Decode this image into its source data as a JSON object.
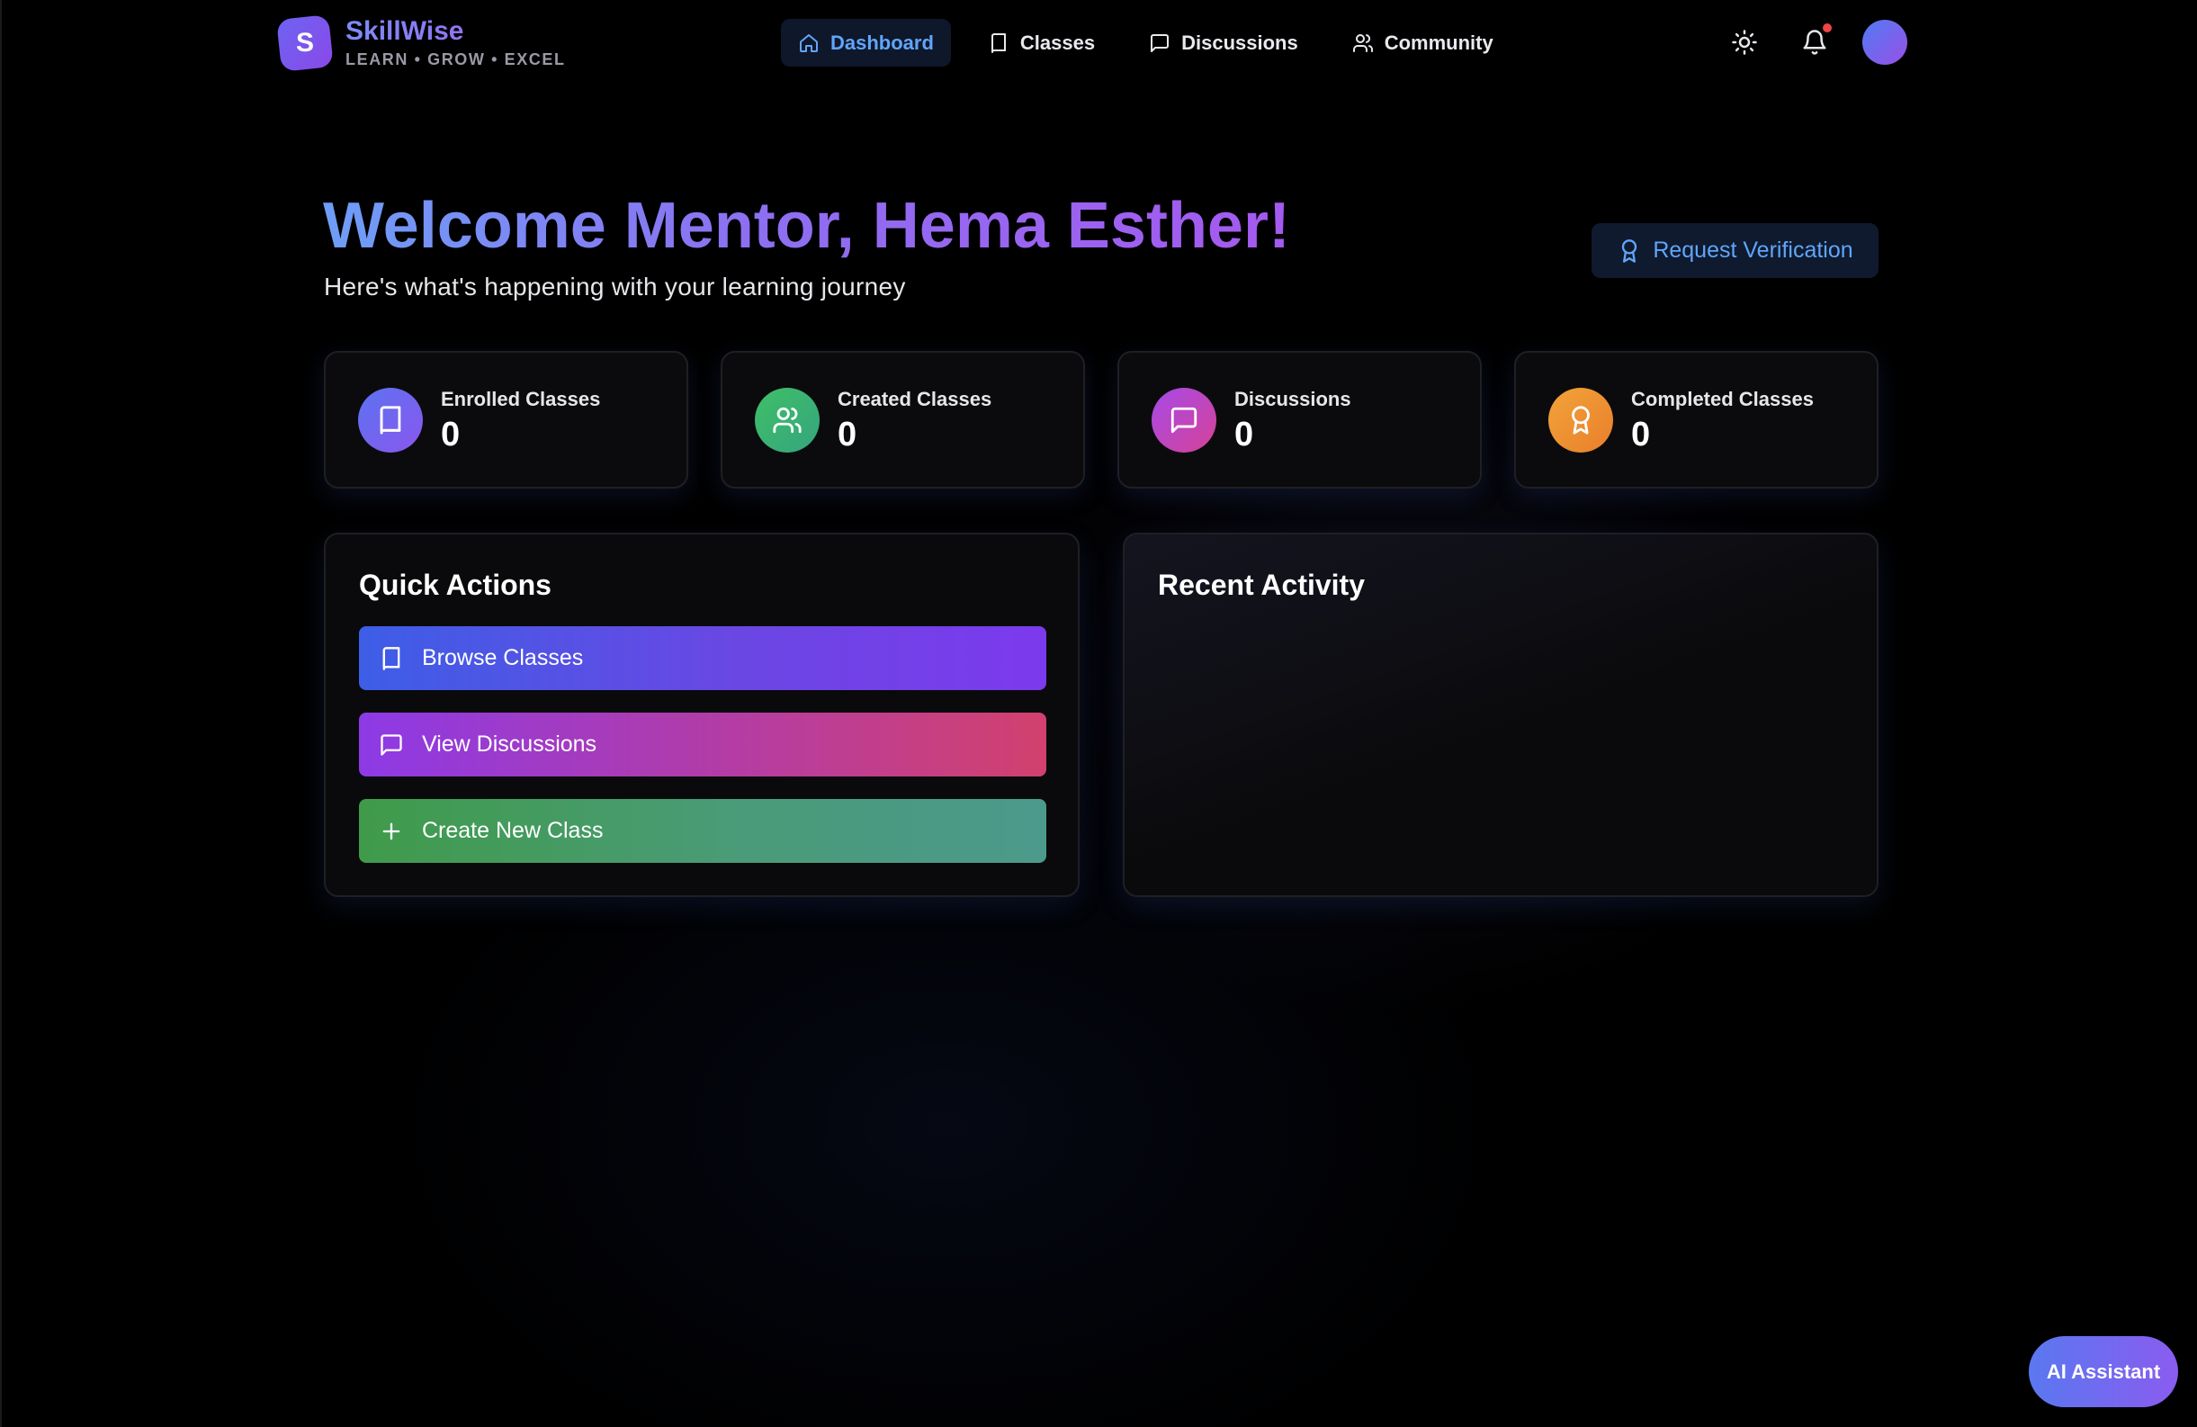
{
  "brand": {
    "logo_letter": "S",
    "name": "SkillWise",
    "tagline": "LEARN • GROW • EXCEL"
  },
  "nav": {
    "items": [
      {
        "label": "Dashboard",
        "icon": "home-icon",
        "active": true
      },
      {
        "label": "Classes",
        "icon": "book-icon",
        "active": false
      },
      {
        "label": "Discussions",
        "icon": "message-square-icon",
        "active": false
      },
      {
        "label": "Community",
        "icon": "users-icon",
        "active": false
      }
    ],
    "right_icons": [
      "sun-icon",
      "bell-icon",
      "avatar"
    ]
  },
  "hero": {
    "title": "Welcome Mentor, Hema Esther!",
    "subtitle": "Here's what's happening with your learning journey",
    "verify_button": "Request Verification"
  },
  "stats": [
    {
      "label": "Enrolled Classes",
      "value": "0",
      "icon": "book-icon",
      "color": "#6366f1"
    },
    {
      "label": "Created Classes",
      "value": "0",
      "icon": "users-icon",
      "color": "#22c55e"
    },
    {
      "label": "Discussions",
      "value": "0",
      "icon": "message-square-icon",
      "color": "#c026d3"
    },
    {
      "label": "Completed Classes",
      "value": "0",
      "icon": "award-icon",
      "color": "#f59e0b"
    }
  ],
  "quick_actions": {
    "title": "Quick Actions",
    "buttons": [
      {
        "label": "Browse Classes",
        "icon": "book-icon"
      },
      {
        "label": "View Discussions",
        "icon": "message-square-icon"
      },
      {
        "label": "Create New Class",
        "icon": "plus-icon"
      }
    ]
  },
  "recent_activity": {
    "title": "Recent Activity"
  },
  "ai_assistant": {
    "label": "AI Assistant"
  },
  "colors": {
    "accent_blue": "#60a5fa",
    "accent_purple": "#a855f7",
    "notification": "#ef4444"
  }
}
